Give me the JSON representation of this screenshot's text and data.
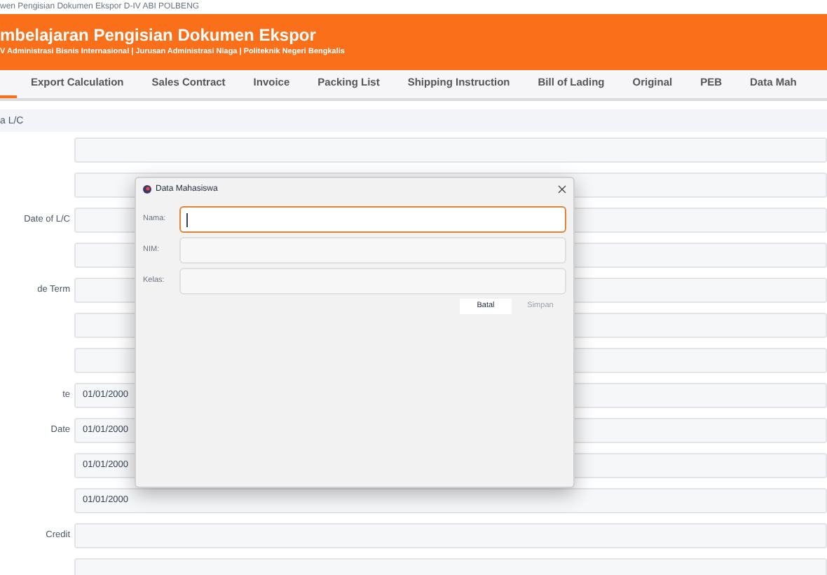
{
  "window": {
    "title": "wen Pengisian Dokumen Ekspor D-IV ABI POLBENG"
  },
  "header": {
    "title": "mbelajaran Pengisian Dokumen Ekspor",
    "subtitle": "V Administrasi Bisnis Internasional | Jurusan Administrasi Niaga | Politeknik Negeri Bengkalis"
  },
  "tabs": [
    {
      "selected": true
    },
    {
      "label": "Export Calculation",
      "selected": false
    },
    {
      "label": "Sales Contract",
      "selected": false
    },
    {
      "label": "Invoice",
      "selected": false
    },
    {
      "label": "Packing List",
      "selected": false
    },
    {
      "label": "Shipping Instruction",
      "selected": false
    },
    {
      "label": "Bill of Lading",
      "selected": false
    },
    {
      "label": "Original",
      "selected": false
    },
    {
      "label": "PEB",
      "selected": false
    },
    {
      "label": "Data Mah",
      "selected": false
    }
  ],
  "section": {
    "title": "a L/C"
  },
  "form_rows": [
    {},
    {},
    {
      "label": "Date of L/C"
    },
    {},
    {
      "label": "de Term"
    },
    {},
    {},
    {
      "label": "te",
      "value": "01/01/2000"
    },
    {
      "label": "Date",
      "value": "01/01/2000"
    },
    {
      "value": "01/01/2000"
    },
    {
      "value": "01/01/2000"
    },
    {
      "label": "Credit"
    },
    {}
  ],
  "dialog": {
    "title": "Data Mahasiswa",
    "fields": [
      {
        "label": "Nama:",
        "focused": true
      },
      {
        "label": "NIM:",
        "focused": false
      },
      {
        "label": "Kelas:",
        "focused": false
      }
    ],
    "buttons": [
      {
        "label": "Batal",
        "disabled": false
      },
      {
        "label": "Simpan",
        "disabled": true
      }
    ]
  }
}
